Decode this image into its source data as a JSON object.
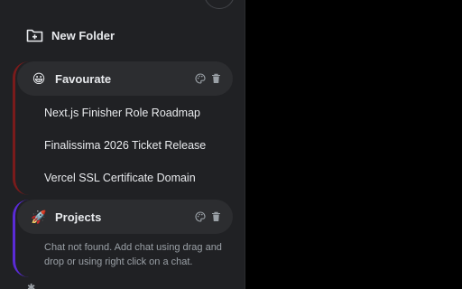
{
  "new_folder": {
    "label": "New Folder",
    "icon": "folder-plus-icon"
  },
  "folders": [
    {
      "name": "Favourate",
      "emoji": "😀",
      "accent_color": "#7a1b1b",
      "chats": [
        "Next.js Finisher Role Roadmap",
        "Finalissima 2026 Ticket Release",
        "Vercel SSL Certificate Domain"
      ]
    },
    {
      "name": "Projects",
      "emoji": "🚀",
      "accent_color": "#5a2bd6",
      "empty_message": "Chat not found. Add chat using drag and drop or using right click on a chat."
    }
  ],
  "icons": {
    "palette": "palette-icon",
    "delete": "trash-icon"
  }
}
